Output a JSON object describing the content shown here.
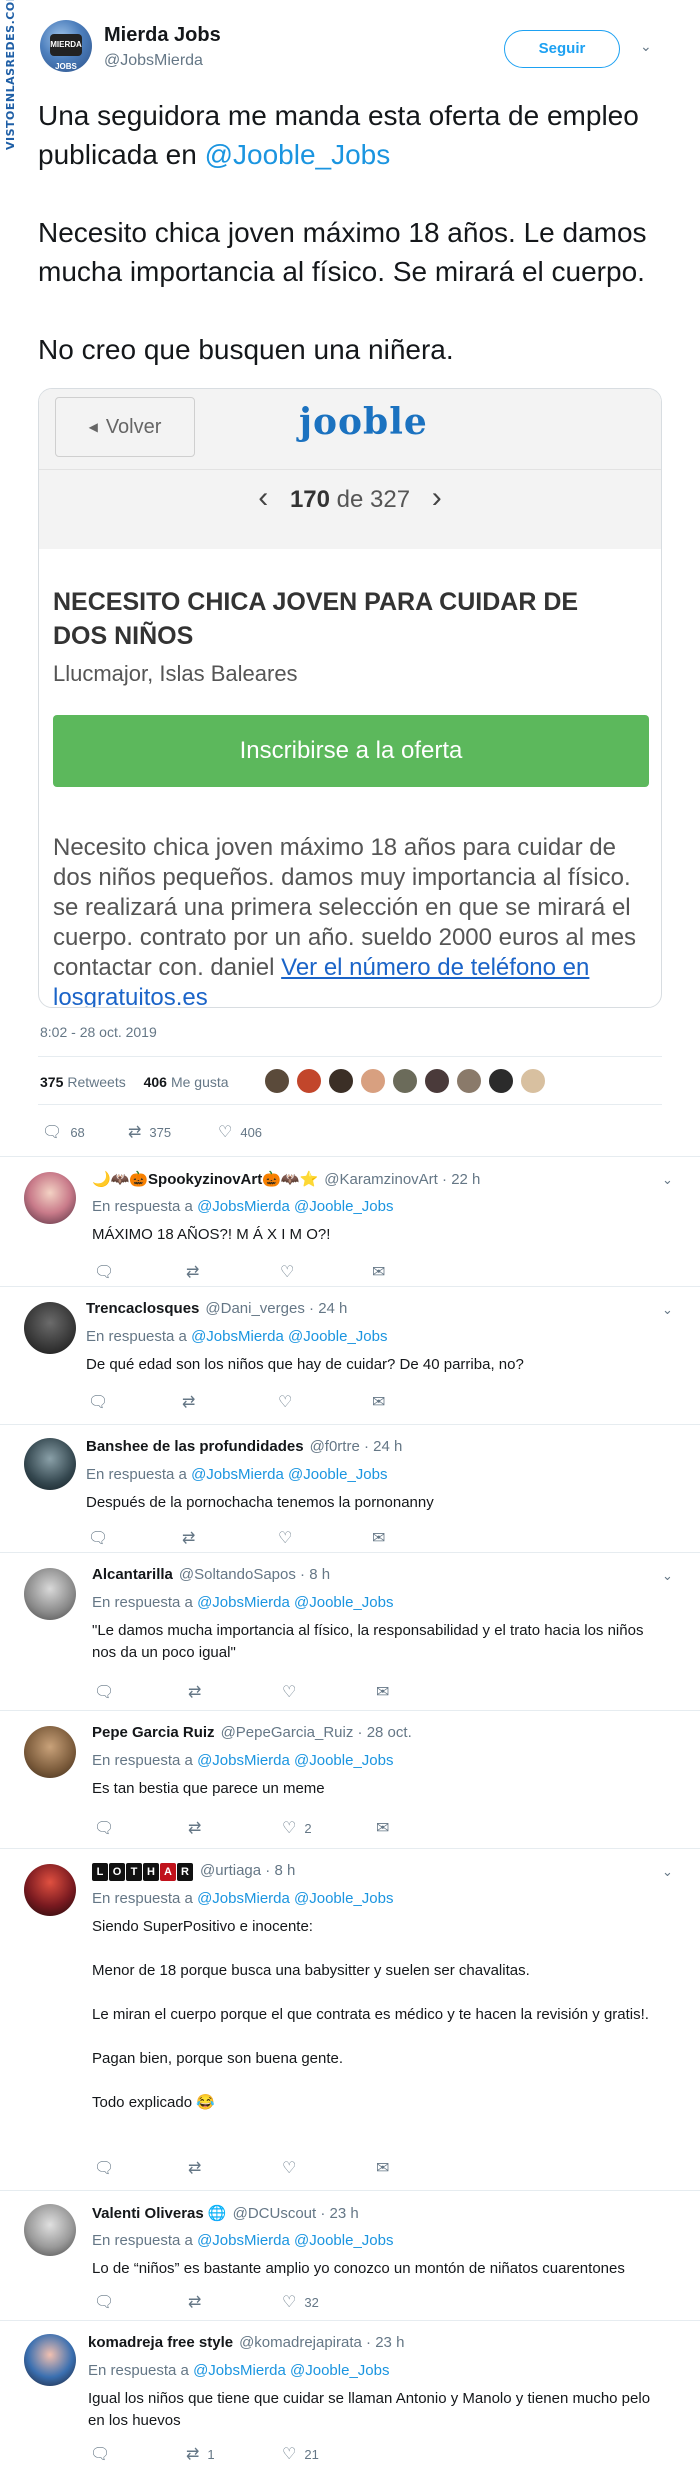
{
  "watermark": "VISTOENLASREDES.COM",
  "main_tweet": {
    "author_name": "Mierda Jobs",
    "author_handle": "@JobsMierda",
    "avatar_text": "MIERDA JOBS",
    "follow_label": "Seguir",
    "text_line1_prefix": "Una seguidora me manda esta oferta de empleo publicada en ",
    "text_line1_mention": "@Jooble_Jobs",
    "text_para2": "Necesito chica joven máximo 18 años. Le damos mucha importancia al físico. Se mirará el cuerpo.",
    "text_para3": "No creo que busquen una niñera.",
    "timestamp": "8:02 - 28 oct. 2019",
    "retweets_count": "375",
    "retweets_label": "Retweets",
    "likes_count": "406",
    "likes_label": "Me gusta",
    "actions": {
      "replies": "68",
      "retweets": "375",
      "likes": "406"
    }
  },
  "embedded_card": {
    "back_label": "Volver",
    "logo": "jooble",
    "page_current": "170",
    "page_of": "de 327",
    "job_title": "NECESITO CHICA JOVEN PARA CUIDAR DE DOS NIÑOS",
    "location": "Llucmajor, Islas Baleares",
    "apply_label": "Inscribirse a la oferta",
    "description": "Necesito chica joven máximo 18 años para cuidar de dos niños pequeños. damos muy importancia al físico. se realizará una primera selección en que se mirará el cuerpo. contrato por un año. sueldo 2000 euros al mes contactar con. daniel ",
    "description_link": "Ver el número de teléfono en losgratuitos.es"
  },
  "in_reply_to_label": "En respuesta a",
  "reply_mentions": [
    "@JobsMierda",
    "@Jooble_Jobs"
  ],
  "replies": [
    {
      "name_prefix": "🌙🦇🎃",
      "name": "SpookyzinovArt",
      "name_suffix": "🎃🦇⭐",
      "handle": "@KaramzinovArt",
      "time": "22 h",
      "text": "MÁXIMO 18 AÑOS?! M Á X I M O?!",
      "counts": {
        "replies": "",
        "retweets": "",
        "likes": ""
      }
    },
    {
      "name": "Trencaclosques",
      "handle": "@Dani_verges",
      "time": "24 h",
      "text": "De qué edad son los niños que hay de cuidar? De 40 parriba, no?",
      "counts": {
        "replies": "",
        "retweets": "",
        "likes": ""
      }
    },
    {
      "name": "Banshee de las profundidades",
      "handle": "@f0rtre",
      "time": "24 h",
      "text": "Después de la pornochacha tenemos la pornonanny",
      "counts": {
        "replies": "",
        "retweets": "",
        "likes": ""
      }
    },
    {
      "name": "Alcantarilla",
      "handle": "@SoltandoSapos",
      "time": "8 h",
      "text": "\"Le damos mucha importancia al físico, la responsabilidad y el trato hacia los niños nos da un poco igual\"",
      "counts": {
        "replies": "",
        "retweets": "",
        "likes": ""
      }
    },
    {
      "name": "Pepe Garcia Ruiz",
      "handle": "@PepeGarcia_Ruiz",
      "time": "28 oct.",
      "text": "Es tan bestia que parece un meme",
      "counts": {
        "replies": "",
        "retweets": "",
        "likes": "2"
      }
    },
    {
      "name_letters": [
        "L",
        "O",
        "T",
        "H",
        "A",
        "R"
      ],
      "handle": "@urtiaga",
      "time": "8 h",
      "paragraphs": [
        "Siendo SuperPositivo e inocente:",
        "Menor de 18 porque busca una babysitter y suelen ser chavalitas.",
        "Le miran el cuerpo porque el que contrata es médico y te hacen la revisión y gratis!.",
        "Pagan bien, porque son buena gente.",
        "Todo explicado 😂"
      ],
      "counts": {
        "replies": "",
        "retweets": "",
        "likes": ""
      }
    },
    {
      "name": "Valenti Oliveras",
      "name_suffix": "🌐",
      "handle": "@DCUscout",
      "time": "23 h",
      "text": "Lo de “niños” es bastante amplio yo conozco un montón de niñatos cuarentones",
      "counts": {
        "replies": "",
        "retweets": "",
        "likes": "32"
      }
    },
    {
      "name": "komadreja free style",
      "handle": "@komadrejapirata",
      "time": "23 h",
      "text": "Igual los niños que tiene que cuidar se llaman Antonio y Manolo y tienen mucho pelo en los huevos",
      "counts": {
        "replies": "",
        "retweets": "1",
        "likes": "21"
      }
    }
  ],
  "colors": {
    "accent": "#1da1f2",
    "mention": "#1b95e0",
    "muted": "#657786",
    "apply_green": "#5cb85c"
  },
  "icons": {
    "reply": "reply-icon",
    "retweet": "retweet-icon",
    "like": "heart-icon",
    "dm": "envelope-icon",
    "caret": "chevron-down-icon"
  }
}
